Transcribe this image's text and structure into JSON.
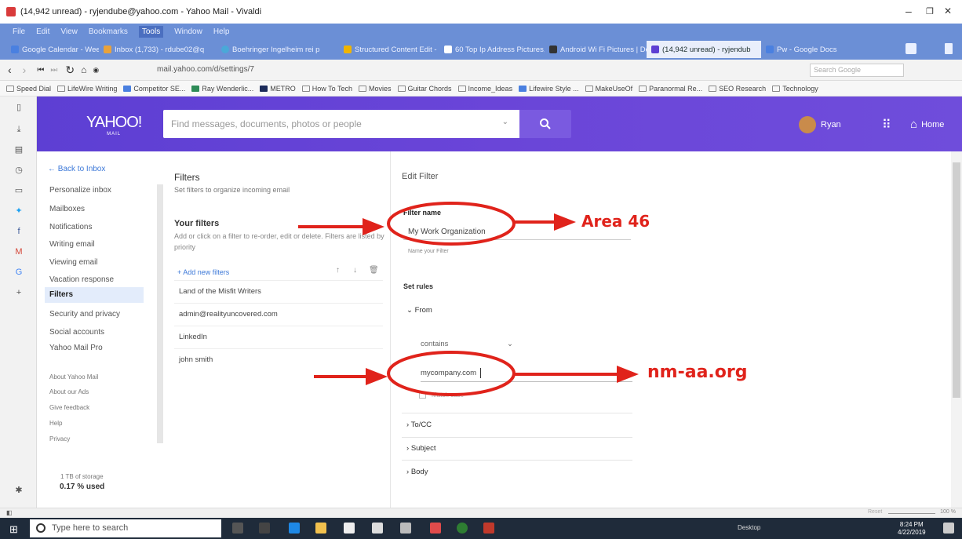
{
  "window": {
    "title": "(14,942 unread) - ryjendube@yahoo.com - Yahoo Mail - Vivaldi",
    "minimize": "–",
    "restore": "❐",
    "close": "✕"
  },
  "menu": [
    "File",
    "Edit",
    "View",
    "Bookmarks",
    "Tools",
    "Window",
    "Help"
  ],
  "tabs": [
    {
      "label": "Google Calendar - Week of",
      "color": "#4a80e0"
    },
    {
      "label": "Inbox (1,733) - rdube02@q",
      "color": "#e9a23b"
    },
    {
      "label": "Boehringer Ingelheim rei p",
      "color": "#4aa8d8"
    },
    {
      "label": "Structured Content Edit - D",
      "color": "#f0b400"
    },
    {
      "label": "60 Top Ip Address Pictures,",
      "color": "#ffffff"
    },
    {
      "label": "Android Wi Fi Pictures | Do",
      "color": "#333333"
    },
    {
      "label": "(14,942 unread) - ryjendub",
      "color": "#5d3fd3"
    },
    {
      "label": "Pw - Google Docs",
      "color": "#4a80e0"
    }
  ],
  "address": {
    "url": "mail.yahoo.com/d/settings/7",
    "search_placeholder": "Search Google"
  },
  "bookmarks": [
    "Speed Dial",
    "LifeWire Writing",
    "Competitor SE...",
    "Ray Wenderlic...",
    "METRO",
    "How To Tech",
    "Movies",
    "Guitar Chords",
    "Income_Ideas",
    "Lifewire Style ...",
    "MakeUseOf",
    "Paranormal Re...",
    "SEO Research",
    "Technology"
  ],
  "yahoo": {
    "logo": "YAHOO!",
    "logo_sub": "MAIL",
    "search_placeholder": "Find messages, documents, photos or people",
    "user": "Ryan",
    "home": "Home"
  },
  "settings_nav": {
    "back": "Back to Inbox",
    "items": [
      "Personalize inbox",
      "Mailboxes",
      "Notifications",
      "Writing email",
      "Viewing email",
      "Vacation response",
      "Filters",
      "Security and privacy",
      "Social accounts",
      "Yahoo Mail Pro"
    ],
    "links": [
      "About Yahoo Mail",
      "About our Ads",
      "Give feedback",
      "Help",
      "Privacy"
    ],
    "storage": "1 TB of storage",
    "used": "0.17 % used"
  },
  "filters": {
    "title": "Filters",
    "subtitle": "Set filters to organize incoming email",
    "your_filters": "Your filters",
    "description": "Add or click on a filter to re-order, edit or delete. Filters are listed by priority",
    "add": "Add new filters",
    "list": [
      "Land of the Misfit Writers",
      "admin@realityuncovered.com",
      "LinkedIn",
      "john smith"
    ]
  },
  "edit_filter": {
    "header": "Edit Filter",
    "name_label": "Filter name",
    "name_value": "My Work Organization",
    "name_hint": "Name your Filter",
    "set_rules": "Set rules",
    "from": "From",
    "condition": "contains",
    "value": "mycompany.com",
    "case_label": "Match case",
    "to_cc": "To/CC",
    "subject": "Subject",
    "body": "Body"
  },
  "annotations": {
    "area": "Area 46",
    "domain": "nm-aa.org",
    "color": "#e0231b"
  },
  "status": {
    "zoom": "100 %",
    "reset": "Reset"
  },
  "taskbar": {
    "search": "Type here to search",
    "desktop": "Desktop",
    "time": "8:24 PM",
    "date": "4/22/2019"
  }
}
